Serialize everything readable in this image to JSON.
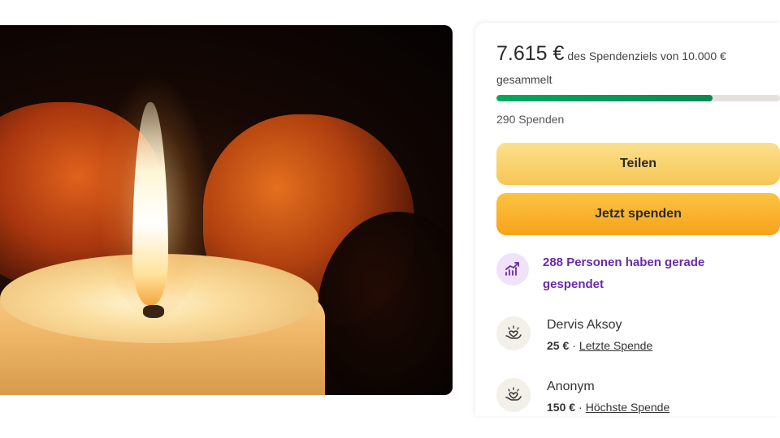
{
  "hero": {
    "image": "candle-in-hands-image"
  },
  "fundraiser": {
    "raised": "7.615 €",
    "goal_text_1": "des Spendenziels von 10.000 €",
    "goal_text_2": "gesammelt",
    "progress_fraction": 0.7615,
    "donations_count": "290 Spenden",
    "progress_color": "#02a95c"
  },
  "buttons": {
    "share_label": "Teilen",
    "donate_label": "Jetzt spenden"
  },
  "trend": {
    "icon": "trending-up-icon",
    "text": "288 Personen haben gerade gespendet"
  },
  "donors": [
    {
      "name": "Dervis Aksoy",
      "amount": "25 €",
      "separator": "·",
      "tag": "Letzte Spende",
      "icon": "heart-hand-icon"
    },
    {
      "name": "Anonym",
      "amount": "150 €",
      "separator": "·",
      "tag": "Höchste Spende",
      "icon": "heart-hand-icon"
    }
  ]
}
